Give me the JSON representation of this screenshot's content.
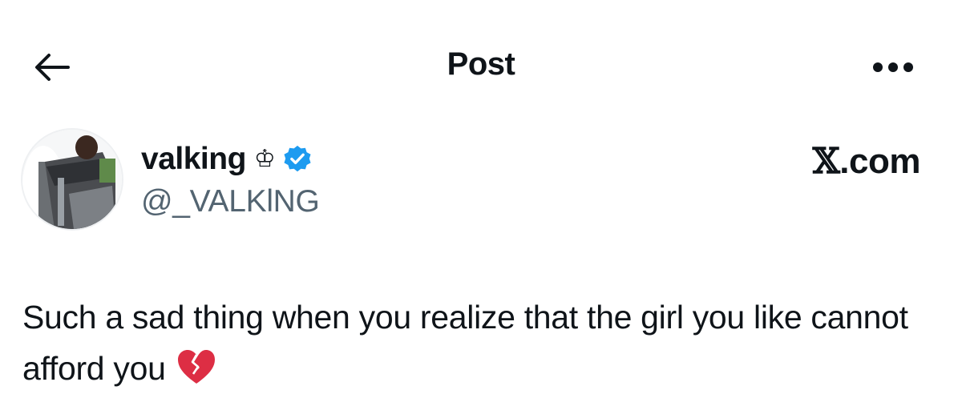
{
  "header": {
    "title": "Post",
    "back_icon": "arrow-left-icon",
    "more_icon": "more-horizontal-icon"
  },
  "author": {
    "display_name": "valking",
    "name_emoji": "♔",
    "verified_icon": "verified-badge-icon",
    "verified_color": "#1d9bf0",
    "handle": "@_VALKlNG"
  },
  "brand": {
    "x_mark": "𝕏",
    "suffix": ".com"
  },
  "post": {
    "text": "Such a sad thing when you realize that the girl you like cannot afford you",
    "emoji_icon": "broken-heart-icon"
  },
  "colors": {
    "text_primary": "#0f1419",
    "text_secondary": "#536471"
  }
}
